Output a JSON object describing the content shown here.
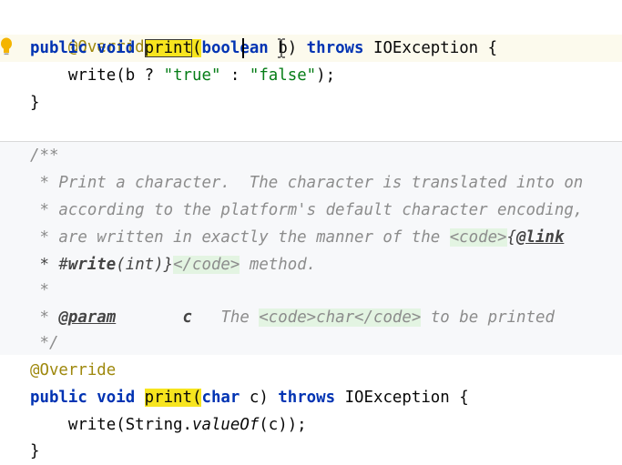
{
  "code": {
    "line0": {
      "ann": "@Override"
    },
    "line1": {
      "kw1": "public void ",
      "method": "print",
      "paren": "(",
      "type": "boolean",
      "rest": " b) ",
      "kw2": "throws",
      "rest2": " IOException {"
    },
    "line2": {
      "pre": "    write(b ? ",
      "s1": "\"true\"",
      "mid": " : ",
      "s2": "\"false\"",
      "post": ");"
    },
    "line3": {
      "brace": "}"
    },
    "doc0": {
      "text": "/**"
    },
    "doc1": {
      "text": " * Print a character.  The character is translated into on"
    },
    "doc2": {
      "text": " * according to the platform's default character encoding,"
    },
    "doc3": {
      "pre": " * are written in exactly the manner of the ",
      "tag": "<code>",
      "brace": "{",
      "link": "@link"
    },
    "doc4": {
      "pre": " * #",
      "bold": "write",
      "args": "(int)}",
      "tag": "</code>",
      "post": " method."
    },
    "doc5": {
      "text": " *"
    },
    "doc6": {
      "pre": " * ",
      "param": "@param",
      "gap": "       ",
      "name": "c",
      "gap2": "   The ",
      "tag1": "<code>",
      "code": "char",
      "tag2": "</code>",
      "post": " to be printed"
    },
    "doc7": {
      "text": " */"
    },
    "line4": {
      "ann": "@Override"
    },
    "line5": {
      "kw1": "public void ",
      "method": "print",
      "paren": "(",
      "kw_char": "char",
      "rest": " c) ",
      "kw2": "throws",
      "rest2": " IOException {"
    },
    "line6": {
      "pre": "    write(String.",
      "static": "valueOf",
      "post": "(c));"
    },
    "line7": {
      "brace": "}"
    }
  },
  "colors": {
    "keyword": "#0033b3",
    "string": "#067d17",
    "annotation": "#9e880d",
    "highlight": "#f7e51e",
    "doc": "#8c8c8c"
  },
  "icons": {
    "gutter": "lightbulb-icon",
    "cursor": "text-cursor-icon"
  }
}
